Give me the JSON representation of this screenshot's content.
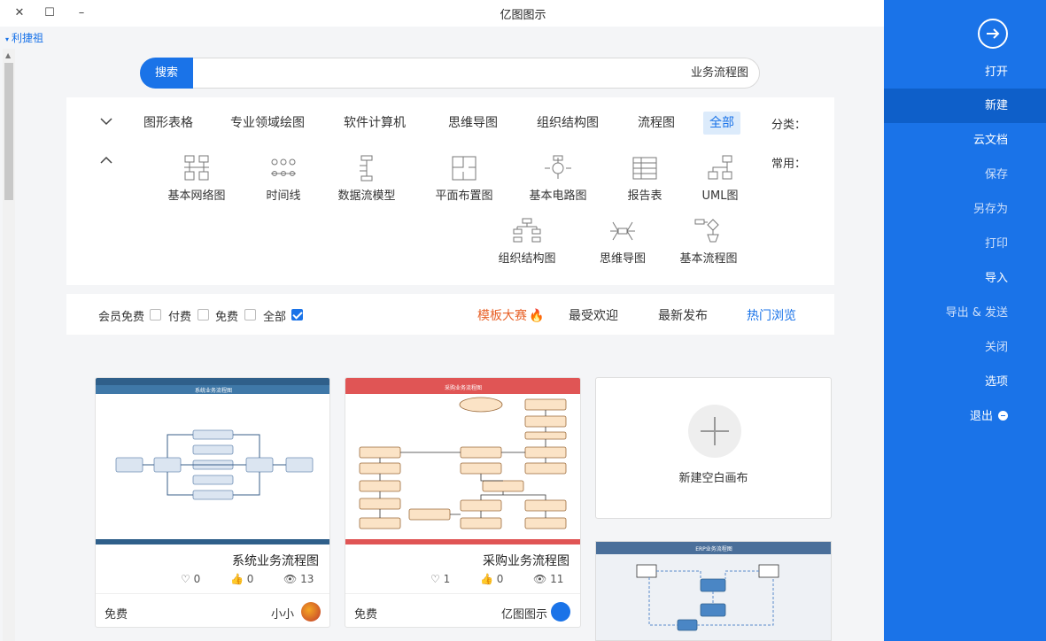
{
  "window": {
    "title": "亿图图示",
    "close": "✕",
    "maximize": "☐",
    "minimize": "–"
  },
  "user": {
    "name": "利捷祖",
    "caret": "▾"
  },
  "search": {
    "button_label": "搜索",
    "query": "业务流程图"
  },
  "categories": {
    "label": "分类：",
    "items": [
      "全部",
      "流程图",
      "组织结构图",
      "思维导图",
      "软件计算机",
      "专业领域绘图",
      "图形表格"
    ],
    "active": "全部",
    "collapse_icon": "chevron-down",
    "expand_icon": "chevron-up"
  },
  "common": {
    "label": "常用：",
    "row1": [
      "UML图",
      "报告表",
      "基本电路图",
      "平面布置图",
      "数据流模型",
      "时间线",
      "基本网络图"
    ],
    "row2": [
      "基本流程图",
      "思维导图",
      "组织结构图"
    ]
  },
  "sort": {
    "hot": "热门浏览",
    "newest": "最新发布",
    "popular": "最受欢迎",
    "contest": "模板大赛"
  },
  "filters": [
    {
      "label": "全部",
      "checked": true
    },
    {
      "label": "免费",
      "checked": false
    },
    {
      "label": "付费",
      "checked": false
    },
    {
      "label": "会员免费",
      "checked": false
    }
  ],
  "cards": [
    {
      "title": "系统业务流程图",
      "views": "13",
      "likes": "0",
      "favorites": "0",
      "author": "小小",
      "price": "免费",
      "header_color": "#2f5f8a",
      "diagram_title": "系统业务流程图"
    },
    {
      "title": "采购业务流程图",
      "views": "11",
      "likes": "0",
      "favorites": "1",
      "author": "亿图图示",
      "price": "免费",
      "header_color": "#e05555",
      "diagram_title": "采购业务流程图"
    }
  ],
  "new_canvas": {
    "label": "新建空白画布"
  },
  "card4": {
    "diagram_title": "ERP业务流程图"
  },
  "sidebar": {
    "items": [
      "打开",
      "新建",
      "云文档",
      "保存",
      "另存为",
      "打印",
      "导入",
      "导出 & 发送",
      "关闭",
      "选项",
      "退出"
    ],
    "active": "新建",
    "dim": [
      "保存",
      "另存为",
      "打印",
      "导出 & 发送",
      "关闭"
    ]
  }
}
